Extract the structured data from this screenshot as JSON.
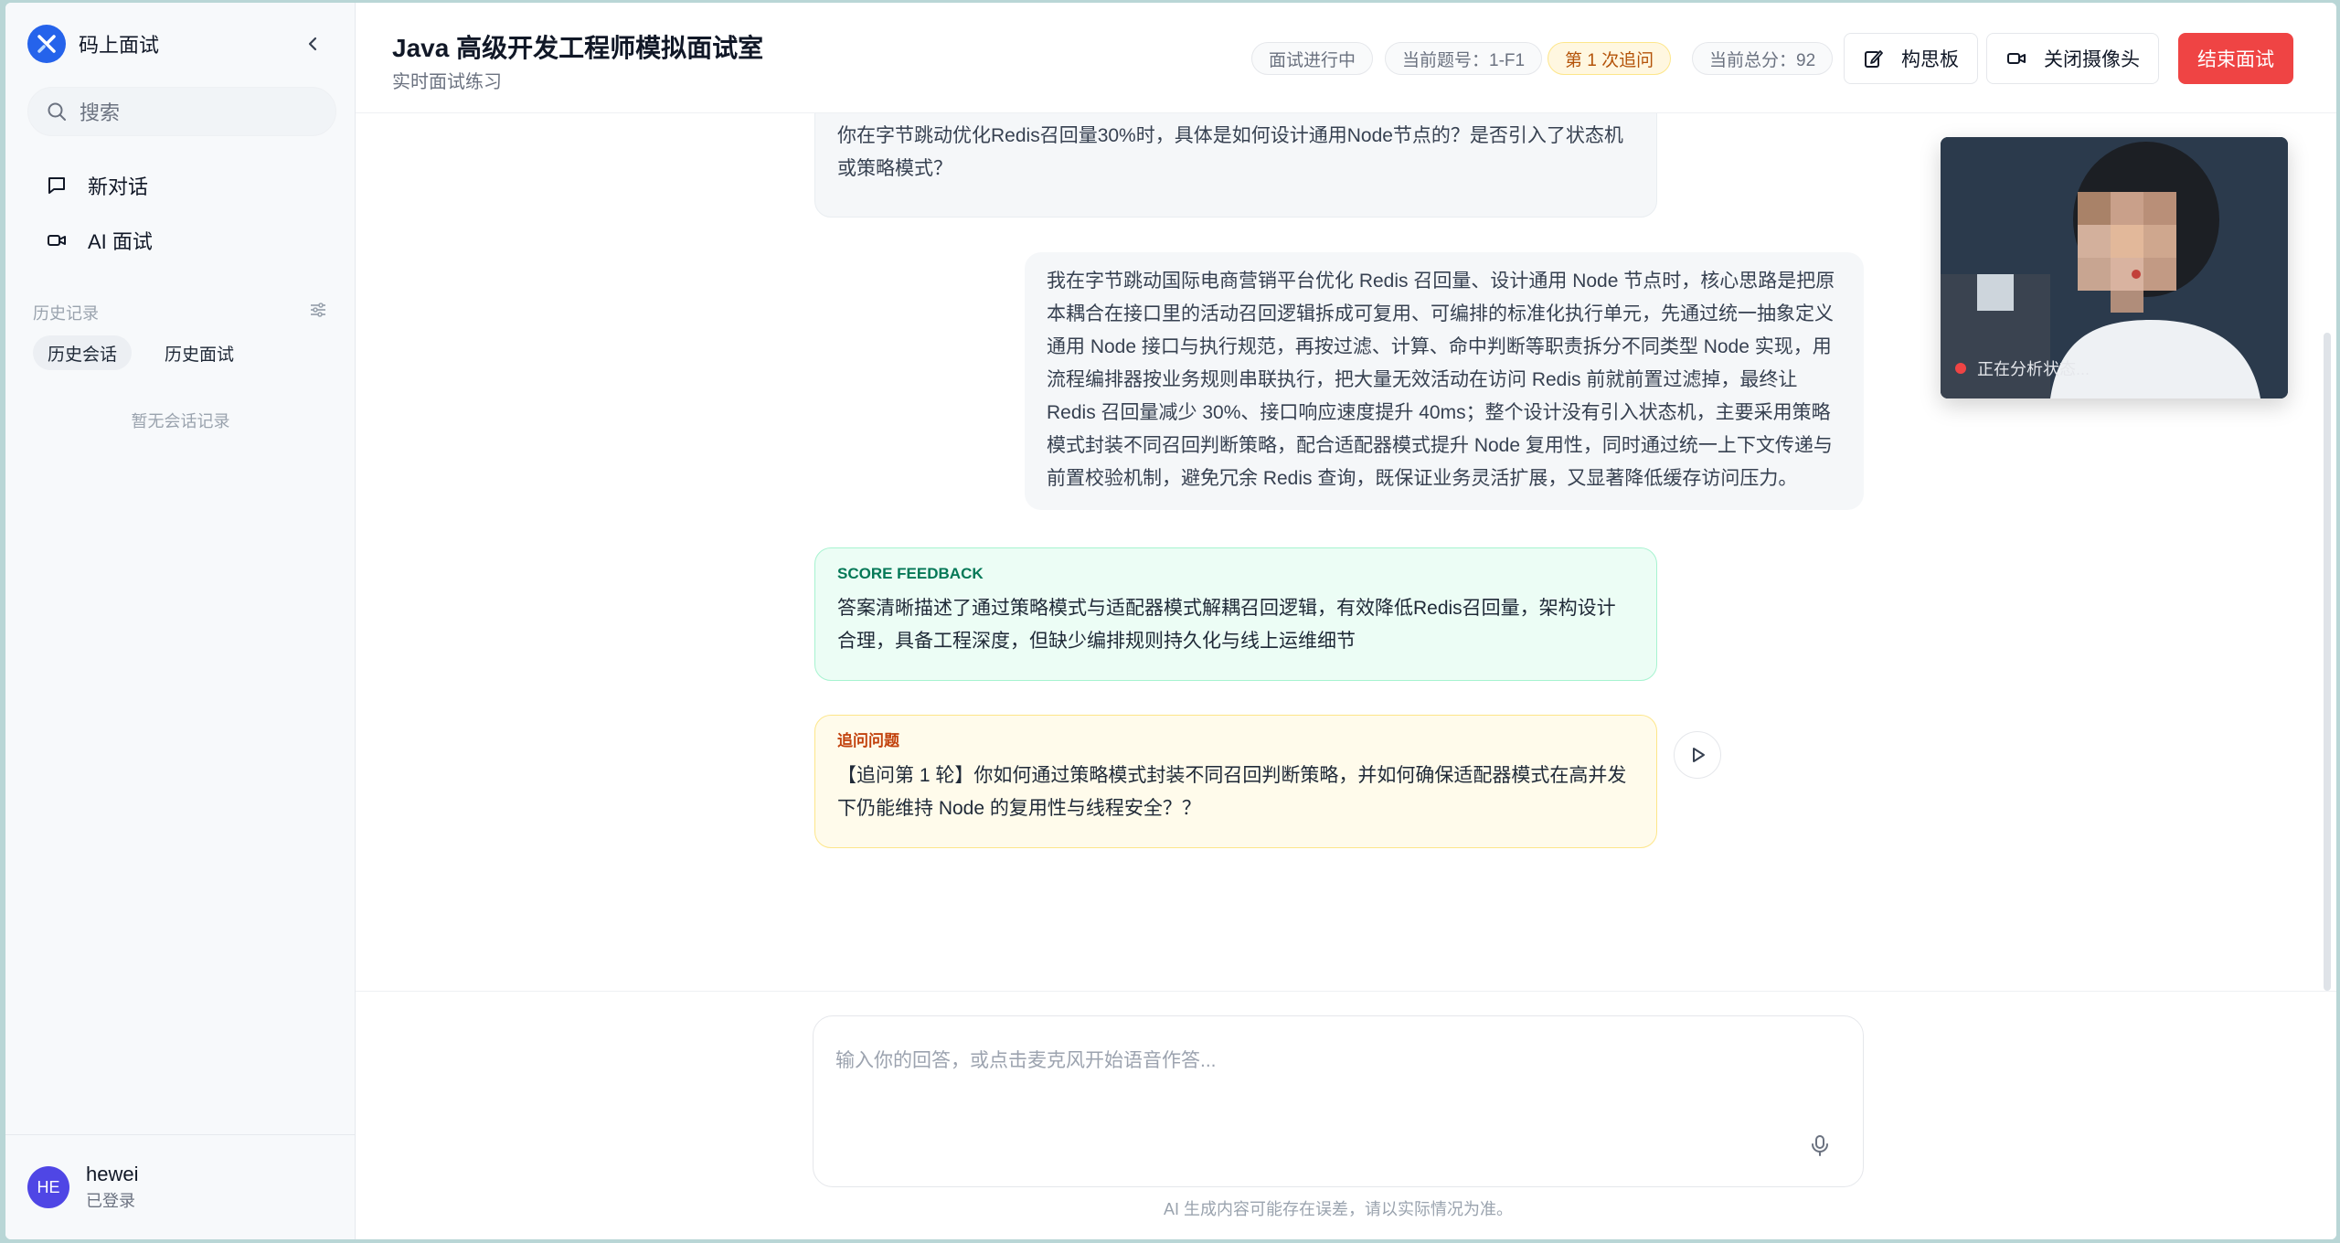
{
  "sidebar": {
    "brand": "码上面试",
    "search_placeholder": "搜索",
    "nav": [
      {
        "label": "新对话",
        "icon": "chat-bubble-icon"
      },
      {
        "label": "AI 面试",
        "icon": "video-camera-icon"
      }
    ],
    "history_title": "历史记录",
    "history_tabs": [
      "历史会话",
      "历史面试"
    ],
    "empty_text": "暂无会话记录",
    "user": {
      "initials": "HE",
      "name": "hewei",
      "status": "已登录"
    }
  },
  "header": {
    "title": "Java 高级开发工程师模拟面试室",
    "subtitle": "实时面试练习",
    "badges": {
      "status": "面试进行中",
      "question": "当前题号：1-F1",
      "followup": "第 1 次追问",
      "score": "当前总分：92"
    },
    "buttons": {
      "whiteboard": "构思板",
      "camera": "关闭摄像头",
      "end": "结束面试"
    }
  },
  "conversation": {
    "ai_question_tail": [
      "你在字节跳动优化Redis召回量30%时，具体是如何设计通用Node节点的？是否引入了状态机",
      "或策略模式？"
    ],
    "user_answer": [
      "我在字节跳动国际电商营销平台优化 Redis 召回量、设计通用 Node 节点时，核心思路是把原",
      "本耦合在接口里的活动召回逻辑拆成可复用、可编排的标准化执行单元，先通过统一抽象定义",
      "通用 Node 接口与执行规范，再按过滤、计算、命中判断等职责拆分不同类型 Node 实现，用",
      "流程编排器按业务规则串联执行，把大量无效活动在访问 Redis 前就前置过滤掉，最终让",
      "Redis 召回量减少 30%、接口响应速度提升 40ms；整个设计没有引入状态机，主要采用策略",
      "模式封装不同召回判断策略，配合适配器模式提升 Node 复用性，同时通过统一上下文传递与",
      "前置校验机制，避免冗余 Redis 查询，既保证业务灵活扩展，又显著降低缓存访问压力。"
    ],
    "score_feedback": {
      "tag": "SCORE FEEDBACK",
      "lines": [
        "答案清晰描述了通过策略模式与适配器模式解耦召回逻辑，有效降低Redis召回量，架构设计",
        "合理，具备工程深度，但缺少编排规则持久化与线上运维细节"
      ]
    },
    "follow_up": {
      "tag": "追问问题",
      "lines": [
        "【追问第 1 轮】你如何通过策略模式封装不同召回判断策略，并如何确保适配器模式在高并发",
        "下仍能维持 Node 的复用性与线程安全？？"
      ]
    }
  },
  "camera": {
    "status": "正在分析状态..."
  },
  "input": {
    "placeholder": "输入你的回答，或点击麦克风开始语音作答...",
    "disclaimer": "AI 生成内容可能存在误差，请以实际情况为准。"
  }
}
